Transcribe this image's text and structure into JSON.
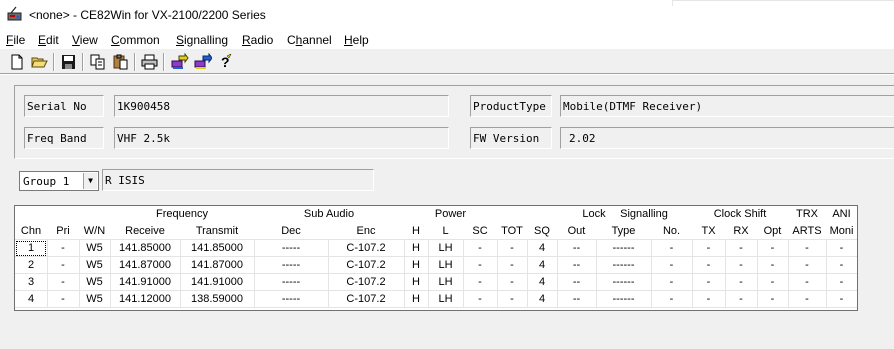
{
  "window": {
    "title": "<none> - CE82Win for VX-2100/2200 Series"
  },
  "menu": {
    "items": [
      {
        "key": "file",
        "label": "File",
        "accel": "F",
        "rest": "ile"
      },
      {
        "key": "edit",
        "label": "Edit",
        "accel": "E",
        "rest": "dit"
      },
      {
        "key": "view",
        "label": "View",
        "accel": "V",
        "rest": "iew"
      },
      {
        "key": "common",
        "label": "Common",
        "accel": "C",
        "rest": "ommon"
      },
      {
        "key": "signalling",
        "label": "Signalling",
        "accel": "S",
        "rest": "ignalling"
      },
      {
        "key": "radio",
        "label": "Radio",
        "accel": "R",
        "rest": "adio"
      },
      {
        "key": "channel",
        "label": "Channel",
        "accel": "h",
        "pre": "C",
        "rest": "annel"
      },
      {
        "key": "help",
        "label": "Help",
        "accel": "H",
        "rest": "elp"
      }
    ]
  },
  "toolbar": {
    "buttons": [
      "new-file-icon",
      "open-folder-icon",
      "save-icon",
      "copy-icon",
      "paste-icon",
      "print-icon",
      "read-radio-icon",
      "write-radio-icon",
      "help-icon"
    ]
  },
  "info": {
    "serial_label": "Serial No",
    "serial_value": "1K900458",
    "freqband_label": "Freq Band",
    "freqband_value": "VHF 2.5k",
    "producttype_label": "ProductType",
    "producttype_value": "Mobile(DTMF Receiver)",
    "fw_label": "FW Version",
    "fw_value": "2.02"
  },
  "group": {
    "selected": "Group 1",
    "name": "R ISIS"
  },
  "grid": {
    "group_headers": {
      "frequency": "Frequency",
      "subaudio": "Sub Audio",
      "power": "Power",
      "lock": "Lock",
      "signalling": "Signalling",
      "clockshift": "Clock Shift",
      "trx": "TRX",
      "ani": "ANI"
    },
    "columns": [
      "Chn",
      "Pri",
      "W/N",
      "Receive",
      "Transmit",
      "Dec",
      "Enc",
      "H",
      "L",
      "SC",
      "TOT",
      "SQ",
      "Out",
      "Type",
      "No.",
      "TX",
      "RX",
      "Opt",
      "ARTS",
      "Moni"
    ],
    "rows": [
      [
        "1",
        "-",
        "W5",
        "141.85000",
        "141.85000",
        "-----",
        "C-107.2",
        "H",
        "LH",
        "-",
        "-",
        "4",
        "--",
        "------",
        "-",
        "-",
        "-",
        "-",
        "-",
        "-"
      ],
      [
        "2",
        "-",
        "W5",
        "141.87000",
        "141.87000",
        "-----",
        "C-107.2",
        "H",
        "LH",
        "-",
        "-",
        "4",
        "--",
        "------",
        "-",
        "-",
        "-",
        "-",
        "-",
        "-"
      ],
      [
        "3",
        "-",
        "W5",
        "141.91000",
        "141.91000",
        "-----",
        "C-107.2",
        "H",
        "LH",
        "-",
        "-",
        "4",
        "--",
        "------",
        "-",
        "-",
        "-",
        "-",
        "-",
        "-"
      ],
      [
        "4",
        "-",
        "W5",
        "141.12000",
        "138.59000",
        "-----",
        "C-107.2",
        "H",
        "LH",
        "-",
        "-",
        "4",
        "--",
        "------",
        "-",
        "-",
        "-",
        "-",
        "-",
        "-"
      ]
    ]
  }
}
